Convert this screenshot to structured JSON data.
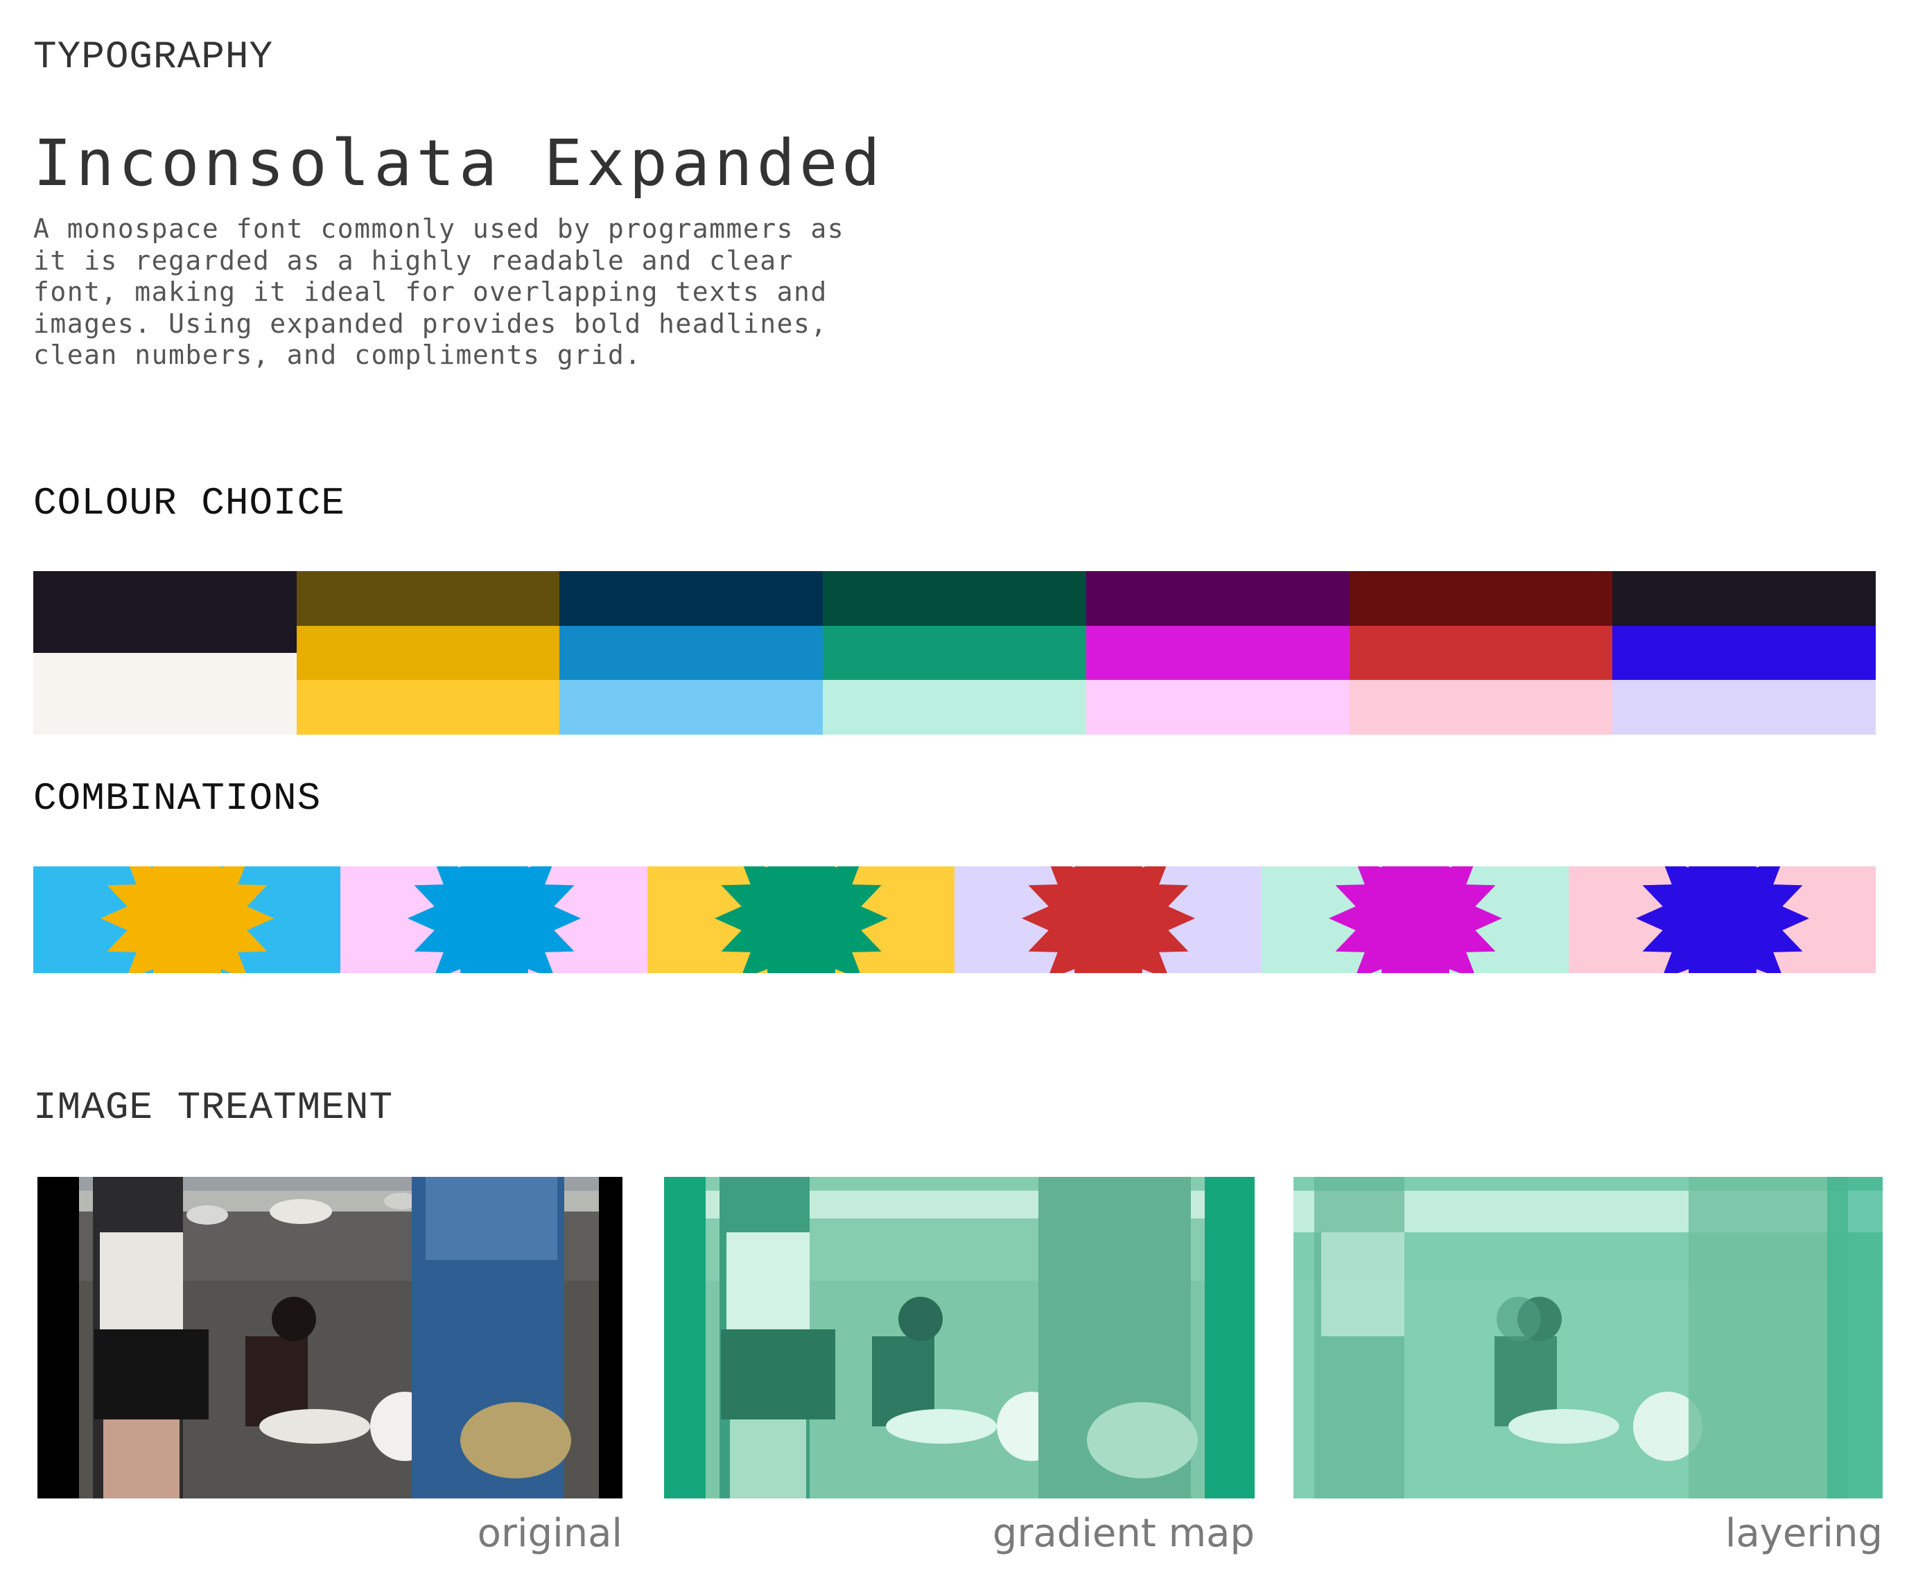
{
  "typography": {
    "heading": "TYPOGRAPHY",
    "font_name": "Inconsolata Expanded",
    "description_lines": [
      "A monospace font commonly used by programmers as",
      "it is regarded as a highly readable and clear",
      "font, making it ideal for overlapping texts and",
      "images. Using expanded provides bold headlines,",
      "clean numbers, and compliments grid."
    ]
  },
  "colour_choice": {
    "heading": "COLOUR CHOICE",
    "columns": [
      [
        "#1b1723",
        "#f5f4ef"
      ],
      [
        "#624f0e",
        "#e5ae00",
        "#fdcb30"
      ],
      [
        "#003150",
        "#128ac7",
        "#74caf4"
      ],
      [
        "#024d3b",
        "#119b74",
        "#bbefdf"
      ],
      [
        "#560058",
        "#d819db",
        "#fecdfe"
      ],
      [
        "#660f0e",
        "#cc3131",
        "#fdcbd7"
      ],
      [
        "#1b1723",
        "#2a0ce5",
        "#dbd5fc"
      ]
    ]
  },
  "combinations": {
    "heading": "COMBINATIONS",
    "items": [
      {
        "background": "#30bbf0",
        "shape": "#f6b400"
      },
      {
        "background": "#fecdfe",
        "shape": "#009ee0"
      },
      {
        "background": "#fecf3b",
        "shape": "#009b6e"
      },
      {
        "background": "#dcd5fd",
        "shape": "#cc2f2f"
      },
      {
        "background": "#bcefdf",
        "shape": "#d412d6"
      },
      {
        "background": "#fdcbd8",
        "shape": "#2a0ce5"
      }
    ]
  },
  "image_treatment": {
    "heading": "IMAGE TREATMENT",
    "images": [
      {
        "caption": "original"
      },
      {
        "caption": "gradient map"
      },
      {
        "caption": "layering"
      }
    ]
  }
}
